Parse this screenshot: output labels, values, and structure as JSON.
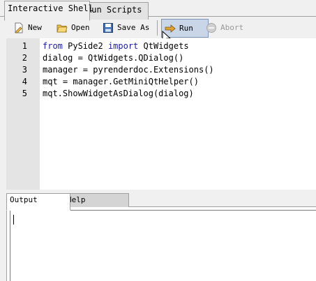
{
  "tabs": [
    {
      "label": "Interactive Shell",
      "active": true
    },
    {
      "label": "Run Scripts",
      "active": false
    }
  ],
  "toolbar": {
    "new_label": "New",
    "open_label": "Open",
    "save_as_label": "Save As",
    "run_label": "Run",
    "abort_label": "Abort",
    "icons": {
      "new": "new-file-icon",
      "open": "open-folder-icon",
      "save_as": "save-disk-icon",
      "run": "run-arrow-icon",
      "abort": "abort-icon"
    }
  },
  "editor": {
    "lines": [
      {
        "number": "1",
        "segments": [
          {
            "text": "from",
            "kw": true
          },
          {
            "text": " PySide2 ",
            "kw": false
          },
          {
            "text": "import",
            "kw": true
          },
          {
            "text": " QtWidgets",
            "kw": false
          }
        ]
      },
      {
        "number": "2",
        "segments": [
          {
            "text": "dialog = QtWidgets.QDialog()",
            "kw": false
          }
        ]
      },
      {
        "number": "3",
        "segments": [
          {
            "text": "manager = pyrenderdoc.Extensions()",
            "kw": false
          }
        ]
      },
      {
        "number": "4",
        "segments": [
          {
            "text": "mqt = manager.GetMiniQtHelper()",
            "kw": false
          }
        ]
      },
      {
        "number": "5",
        "segments": [
          {
            "text": "mqt.ShowWidgetAsDialog(dialog)",
            "kw": false
          }
        ]
      }
    ]
  },
  "bottom_tabs": [
    {
      "label": "Output",
      "active": true
    },
    {
      "label": "Help",
      "active": false
    }
  ],
  "output": {
    "text": ""
  },
  "colors": {
    "keyword": "#1c1ca8",
    "run_button_bg": "#c9d6e8",
    "gutter": "#e4e4e4"
  }
}
